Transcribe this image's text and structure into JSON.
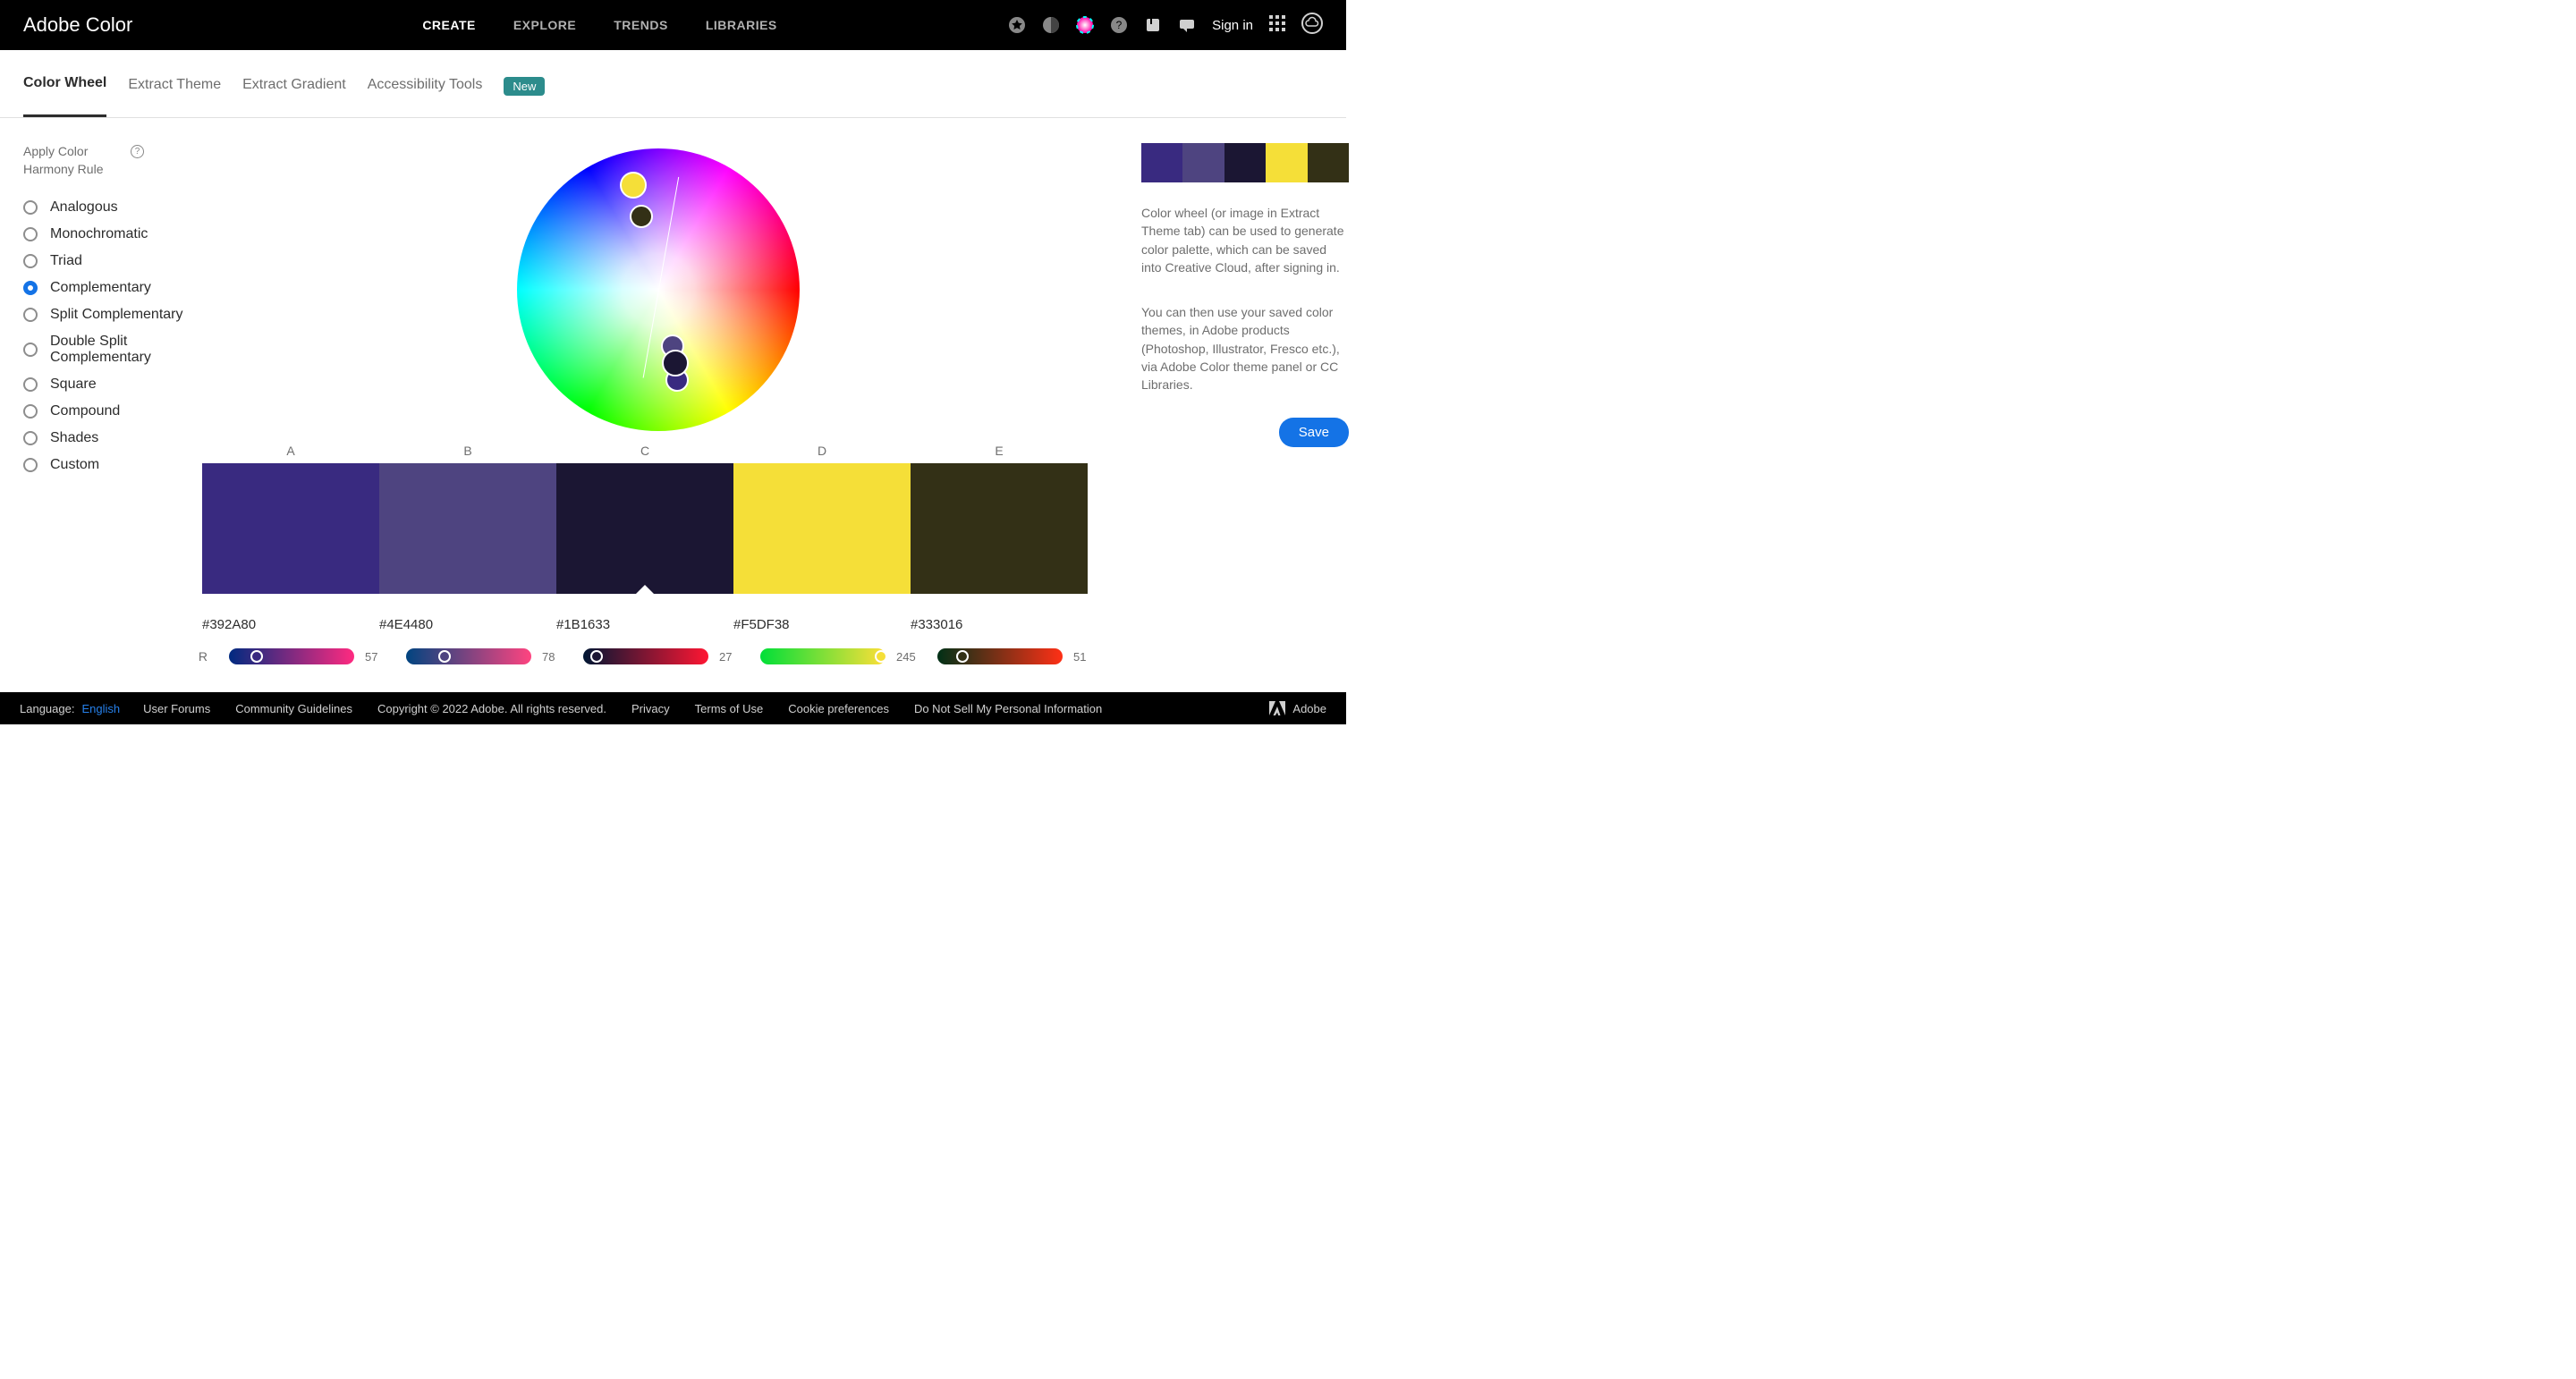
{
  "header": {
    "logo": "Adobe Color",
    "nav": {
      "create": "CREATE",
      "explore": "EXPLORE",
      "trends": "TRENDS",
      "libraries": "LIBRARIES"
    },
    "signin": "Sign in"
  },
  "subtabs": {
    "color_wheel": "Color Wheel",
    "extract_theme": "Extract Theme",
    "extract_gradient": "Extract Gradient",
    "accessibility": "Accessibility Tools",
    "new_badge": "New"
  },
  "harmony": {
    "heading": "Apply Color Harmony Rule",
    "rules": [
      "Analogous",
      "Monochromatic",
      "Triad",
      "Complementary",
      "Split Complementary",
      "Double Split Complementary",
      "Square",
      "Compound",
      "Shades",
      "Custom"
    ],
    "selected": "Complementary"
  },
  "swatch_labels": [
    "A",
    "B",
    "C",
    "D",
    "E"
  ],
  "swatches": [
    {
      "hex": "#392A80"
    },
    {
      "hex": "#4E4480"
    },
    {
      "hex": "#1B1633"
    },
    {
      "hex": "#F5DF38"
    },
    {
      "hex": "#333016"
    }
  ],
  "selected_swatch": 2,
  "rgb": {
    "label": "R",
    "values": [
      57,
      78,
      27,
      245,
      51
    ]
  },
  "right": {
    "p1": "Color wheel (or image in Extract Theme tab) can be used to generate color palette, which can be saved into Creative Cloud, after signing in.",
    "p2": "You can then use your saved color themes, in Adobe products (Photoshop, Illustrator, Fresco etc.), via Adobe Color theme panel or CC Libraries.",
    "save": "Save"
  },
  "footer": {
    "language_label": "Language:",
    "language": "English",
    "links": [
      "User Forums",
      "Community Guidelines",
      "Copyright © 2022 Adobe. All rights reserved.",
      "Privacy",
      "Terms of Use",
      "Cookie preferences",
      "Do Not Sell My Personal Information"
    ],
    "brand": "Adobe"
  }
}
